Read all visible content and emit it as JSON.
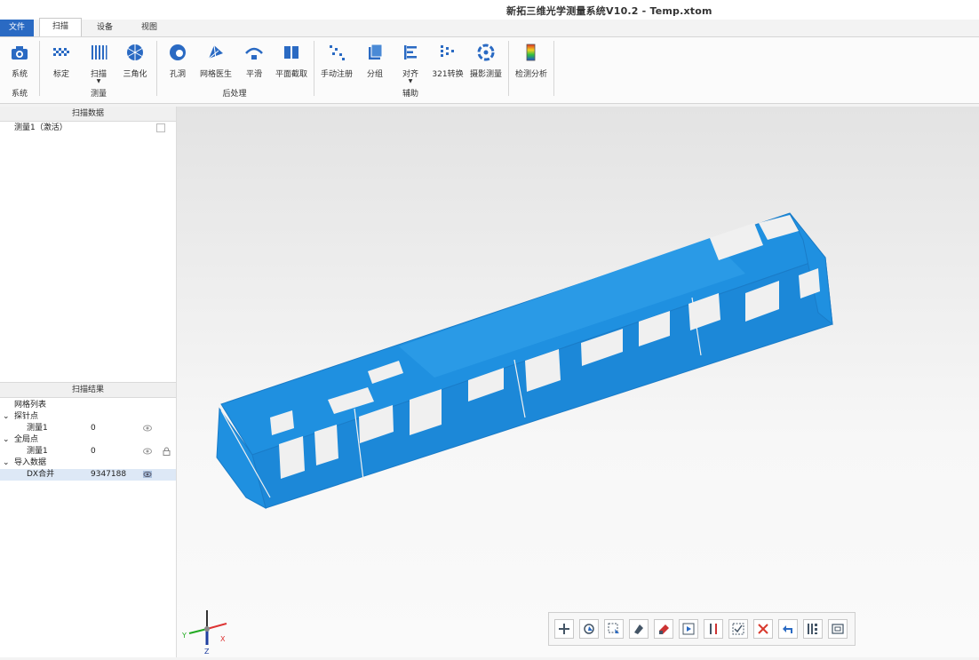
{
  "window": {
    "title": "新拓三维光学测量系统V10.2 - Temp.xtom"
  },
  "tabs": {
    "file": "文件",
    "scan": "扫描",
    "device": "设备",
    "view": "视图"
  },
  "ribbon": {
    "system": {
      "label": "系统",
      "group": "系统"
    },
    "measure": {
      "calibrate": "标定",
      "scan": "扫描",
      "triangulate": "三角化",
      "group": "测量"
    },
    "post": {
      "hole": "孔洞",
      "mesh_doctor": "网格医生",
      "smooth": "平滑",
      "plane_cut": "平面截取",
      "group": "后处理"
    },
    "aux": {
      "manual_reg": "手动注册",
      "grouping": "分组",
      "align": "对齐",
      "conv321": "321转换",
      "photogrammetry": "摄影测量",
      "group": "辅助"
    },
    "inspect": {
      "label": "检测分析"
    }
  },
  "scan_data": {
    "title": "扫描数据",
    "items": [
      {
        "label": "测量1（激活）"
      }
    ]
  },
  "scan_results": {
    "title": "扫描结果",
    "mesh_list": "网格列表",
    "probe": {
      "label": "探针点",
      "item": {
        "name": "测量1",
        "value": "0"
      }
    },
    "global": {
      "label": "全局点",
      "item": {
        "name": "测量1",
        "value": "0"
      }
    },
    "import": {
      "label": "导入数据",
      "item": {
        "name": "DX合并",
        "value": "9347188"
      }
    }
  },
  "axes": {
    "x": "X",
    "y": "Y",
    "z": "Z"
  },
  "colors": {
    "accent": "#2a6ac3",
    "model": "#1f90e0",
    "delete": "#d83a2e"
  },
  "toolbar_icons": [
    "center-icon",
    "rotate-icon",
    "box-select-icon",
    "lasso-icon",
    "brush-select-icon",
    "select-visible-icon",
    "invert-selection-icon",
    "select-all-icon",
    "delete-icon",
    "undo-icon",
    "vertical-bars-icon",
    "fit-view-icon"
  ]
}
